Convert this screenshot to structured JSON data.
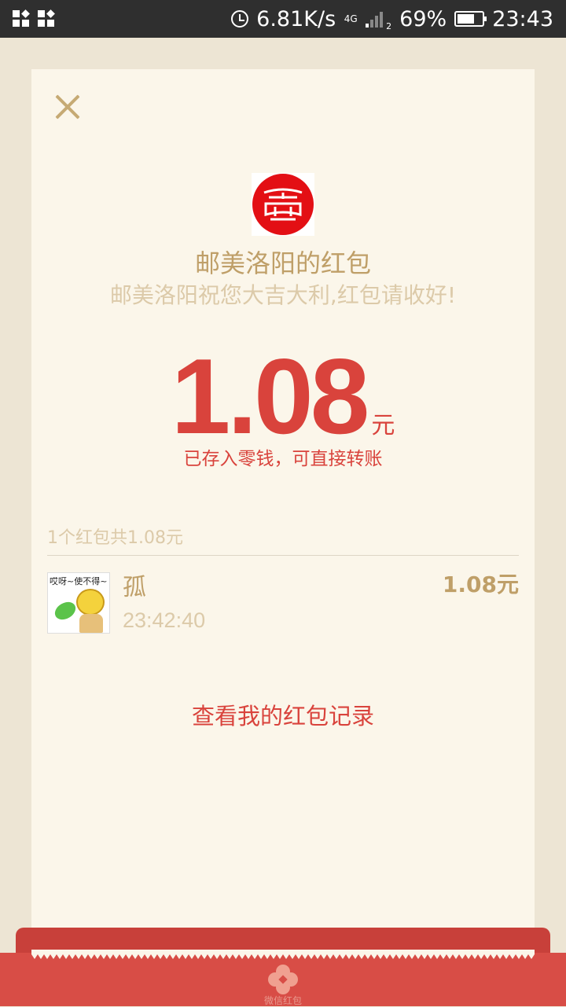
{
  "status_bar": {
    "network_speed": "6.81K/s",
    "network_type": "4G",
    "sim_slot": "2",
    "battery": "69%",
    "battery_level": 0.69,
    "time": "23:43",
    "icons": [
      "app-icon",
      "app-icon",
      "alarm-icon",
      "signal-icon",
      "battery-icon"
    ]
  },
  "packet": {
    "sender_title": "邮美洛阳的红包",
    "greeting": "邮美洛阳祝您大吉大利,红包请收好!",
    "amount": "1.08",
    "amount_unit": "元",
    "saved_note": "已存入零钱，可直接转账"
  },
  "summary": "1个红包共1.08元",
  "records": [
    {
      "avatar_caption": "哎呀~使不得~",
      "name": "孤",
      "time": "23:42:40",
      "amount": "1.08元"
    }
  ],
  "history_link": "查看我的红包记录",
  "footer_badge": "微信红包",
  "colors": {
    "accent_red": "#d9433c",
    "gold": "#bf9f68",
    "muted_gold": "#dccaa9",
    "card_bg": "#fbf6ea",
    "page_bg": "#ede5d4",
    "logo_red": "#e30f14"
  }
}
